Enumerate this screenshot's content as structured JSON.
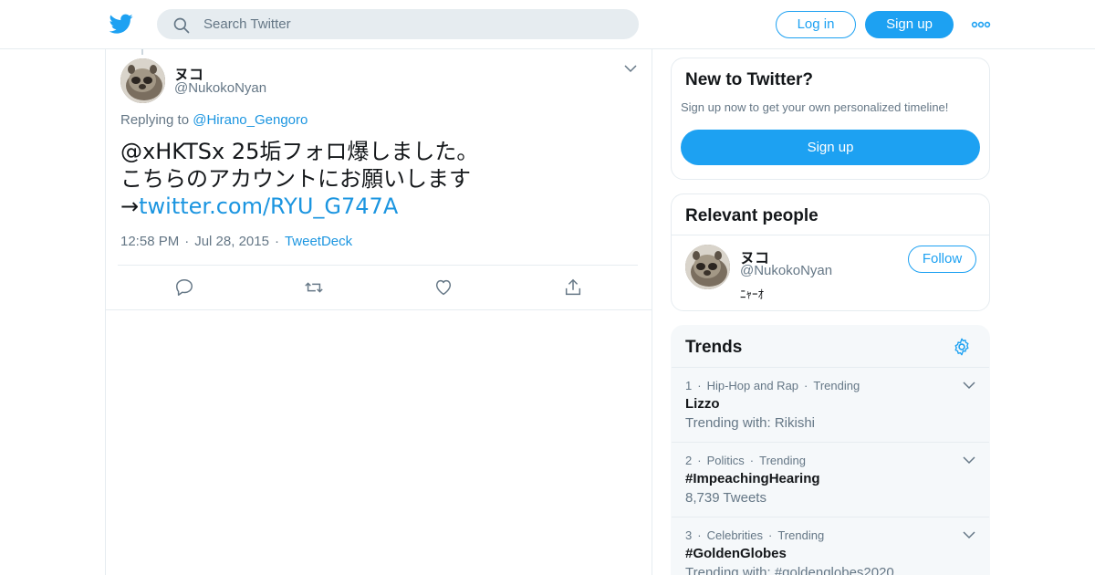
{
  "header": {
    "logo_icon": "twitter-bird-icon",
    "search_placeholder": "Search Twitter",
    "login_label": "Log in",
    "signup_label": "Sign up",
    "more_icon": "more-dots-icon",
    "accent_color": "#1da1f2"
  },
  "tweet": {
    "display_name": "ヌコ",
    "handle": "@NukokoNyan",
    "replying_prefix": "Replying to",
    "replying_to": "@Hirano_Gengoro",
    "text_line1": "@xHKTSx 25垢フォロ爆しました。",
    "text_line2": "こちらのアカウントにお願いします",
    "text_arrow": "→",
    "text_link": "twitter.com/RYU_G747A",
    "time": "12:58 PM",
    "date": "Jul 28, 2015",
    "source": "TweetDeck",
    "meta_separator": "·",
    "actions": [
      "reply-icon",
      "retweet-icon",
      "like-icon",
      "share-icon"
    ]
  },
  "sidebar": {
    "new_to_twitter": {
      "title": "New to Twitter?",
      "subtitle": "Sign up now to get your own personalized timeline!",
      "button_label": "Sign up"
    },
    "relevant_people": {
      "title": "Relevant people",
      "name": "ヌコ",
      "handle": "@NukokoNyan",
      "bio": "ﾆｬｰｵ",
      "follow_label": "Follow"
    },
    "trends": {
      "title": "Trends",
      "settings_icon": "gear-icon",
      "separator": "·",
      "items": [
        {
          "rank": "1",
          "category": "Hip-Hop and Rap",
          "status": "Trending",
          "name": "Lizzo",
          "sub": "Trending with: Rikishi"
        },
        {
          "rank": "2",
          "category": "Politics",
          "status": "Trending",
          "name": "#ImpeachingHearing",
          "sub": "8,739 Tweets"
        },
        {
          "rank": "3",
          "category": "Celebrities",
          "status": "Trending",
          "name": "#GoldenGlobes",
          "sub": "Trending with: #goldenglobes2020"
        }
      ]
    }
  }
}
